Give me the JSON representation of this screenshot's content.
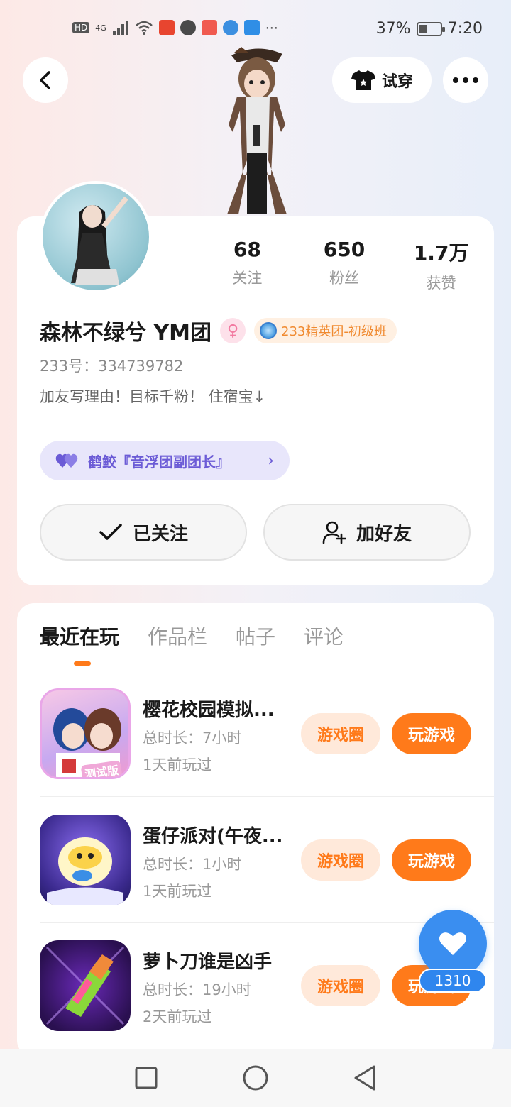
{
  "status_bar": {
    "network": "HD",
    "signal": "4G",
    "battery_percent": "37%",
    "battery_level": 0.37,
    "time": "7:20"
  },
  "header": {
    "try_on_label": "试穿"
  },
  "profile": {
    "stats": [
      {
        "value": "68",
        "label": "关注"
      },
      {
        "value": "650",
        "label": "粉丝"
      },
      {
        "value": "1.7万",
        "label": "获赞"
      }
    ],
    "name": "森林不绿兮 YM团",
    "gender_symbol": "♀",
    "group_badge": "233精英团-初级班",
    "user_id": "233号：334739782",
    "bio": "加友写理由！目标千粉！  住宿宝↓",
    "tag": "鹤鲛『音浮团副团长』",
    "followed_label": "已关注",
    "add_friend_label": "加好友"
  },
  "tabs": [
    {
      "label": "最近在玩",
      "active": true
    },
    {
      "label": "作品栏",
      "active": false
    },
    {
      "label": "帖子",
      "active": false
    },
    {
      "label": "评论",
      "active": false
    }
  ],
  "games": [
    {
      "title": "樱花校园模拟...",
      "duration": "总时长：7小时",
      "last_played": "1天前玩过",
      "circle_label": "游戏圈",
      "play_label": "玩游戏",
      "icon_text": "测试版"
    },
    {
      "title": "蛋仔派对(午夜...",
      "duration": "总时长：1小时",
      "last_played": "1天前玩过",
      "circle_label": "游戏圈",
      "play_label": "玩游戏"
    },
    {
      "title": "萝卜刀谁是凶手",
      "duration": "总时长：19小时",
      "last_played": "2天前玩过",
      "circle_label": "游戏圈",
      "play_label": "玩游戏"
    }
  ],
  "like": {
    "count": "1310"
  }
}
